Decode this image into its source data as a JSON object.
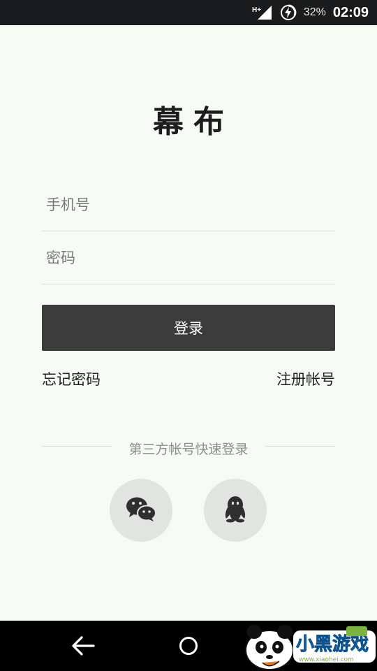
{
  "status_bar": {
    "network": "H+",
    "battery_percent": "32%",
    "time": "02:09",
    "battery_icon": "battery-charging-icon",
    "signal_icon": "cell-signal-icon"
  },
  "app": {
    "logo_text": "幕布"
  },
  "form": {
    "phone_placeholder": "手机号",
    "password_placeholder": "密码",
    "login_label": "登录",
    "forgot_label": "忘记密码",
    "register_label": "注册帐号"
  },
  "social": {
    "divider_text": "第三方帐号快速登录",
    "buttons": [
      {
        "icon": "wechat-icon"
      },
      {
        "icon": "qq-penguin-icon"
      }
    ]
  },
  "nav_bar": {
    "back_icon": "back-arrow-icon",
    "home_icon": "home-circle-icon"
  },
  "watermark": {
    "text": "小黑游戏",
    "url_text": "www.xiaohei.com"
  },
  "colors": {
    "background": "#f5faf4",
    "primary_button": "#3b3b3b",
    "social_circle": "#e2e4e1",
    "status_bar": "#1a1b1c",
    "watermark_blue": "#1e8ee0"
  }
}
